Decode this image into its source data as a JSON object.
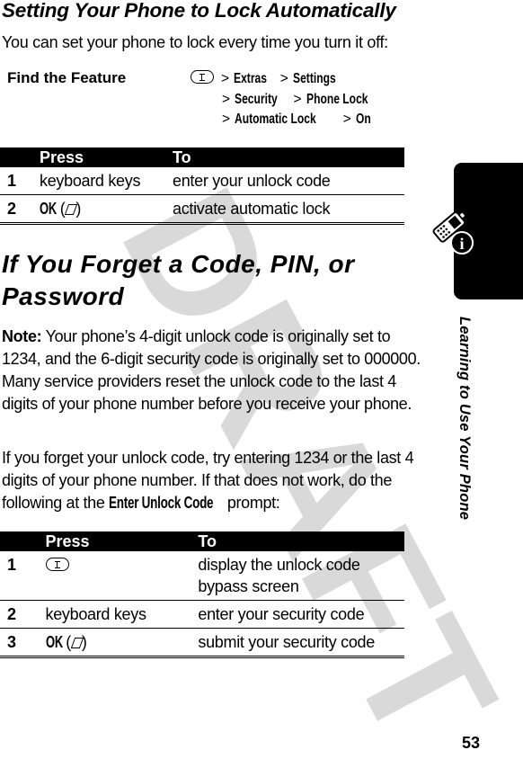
{
  "watermark": "DRAFT",
  "section1": {
    "title": "Setting Your Phone to Lock Automatically",
    "intro": "You can set your phone to lock every time you turn it off:",
    "find_feature": {
      "label": "Find the Feature",
      "icon": "menu-key-icon",
      "path": [
        [
          "Extras",
          "Settings"
        ],
        [
          "Security",
          "Phone Lock"
        ],
        [
          "Automatic Lock",
          "On"
        ]
      ],
      "separator": ">"
    },
    "table": {
      "headers": [
        "Press",
        "To"
      ],
      "rows": [
        {
          "num": "1",
          "press": "keyboard keys",
          "to": "enter your unlock code"
        },
        {
          "num": "2",
          "press": "OK",
          "press_icon": "right-soft-key-icon",
          "to": "activate automatic lock"
        }
      ]
    }
  },
  "section2": {
    "title": "If You Forget a Code, PIN, or Password",
    "note_label": "Note:",
    "note_text": " Your phone’s 4-digit unlock code is originally set to 1234, and the 6-digit security code is originally set to 000000. Many service providers reset the unlock code to the last 4 digits of your phone number before you receive your phone.",
    "para_before": "If you forget your unlock code, try entering 1234 or the last 4 digits of your phone number. If that does not work, do the following at the ",
    "para_keyword": "Enter Unlock Code",
    "para_after": " prompt:",
    "table": {
      "headers": [
        "Press",
        "To"
      ],
      "rows": [
        {
          "num": "1",
          "press": "",
          "press_icon": "menu-key-icon",
          "to": "display the unlock code bypass screen"
        },
        {
          "num": "2",
          "press": "keyboard keys",
          "to": "enter your security code"
        },
        {
          "num": "3",
          "press": "OK",
          "press_icon": "right-soft-key-icon",
          "to": "submit your security code"
        }
      ]
    }
  },
  "sidebar": {
    "chapter": "Learning to Use Your Phone",
    "icon": "phone-info-icon"
  },
  "page_number": "53"
}
